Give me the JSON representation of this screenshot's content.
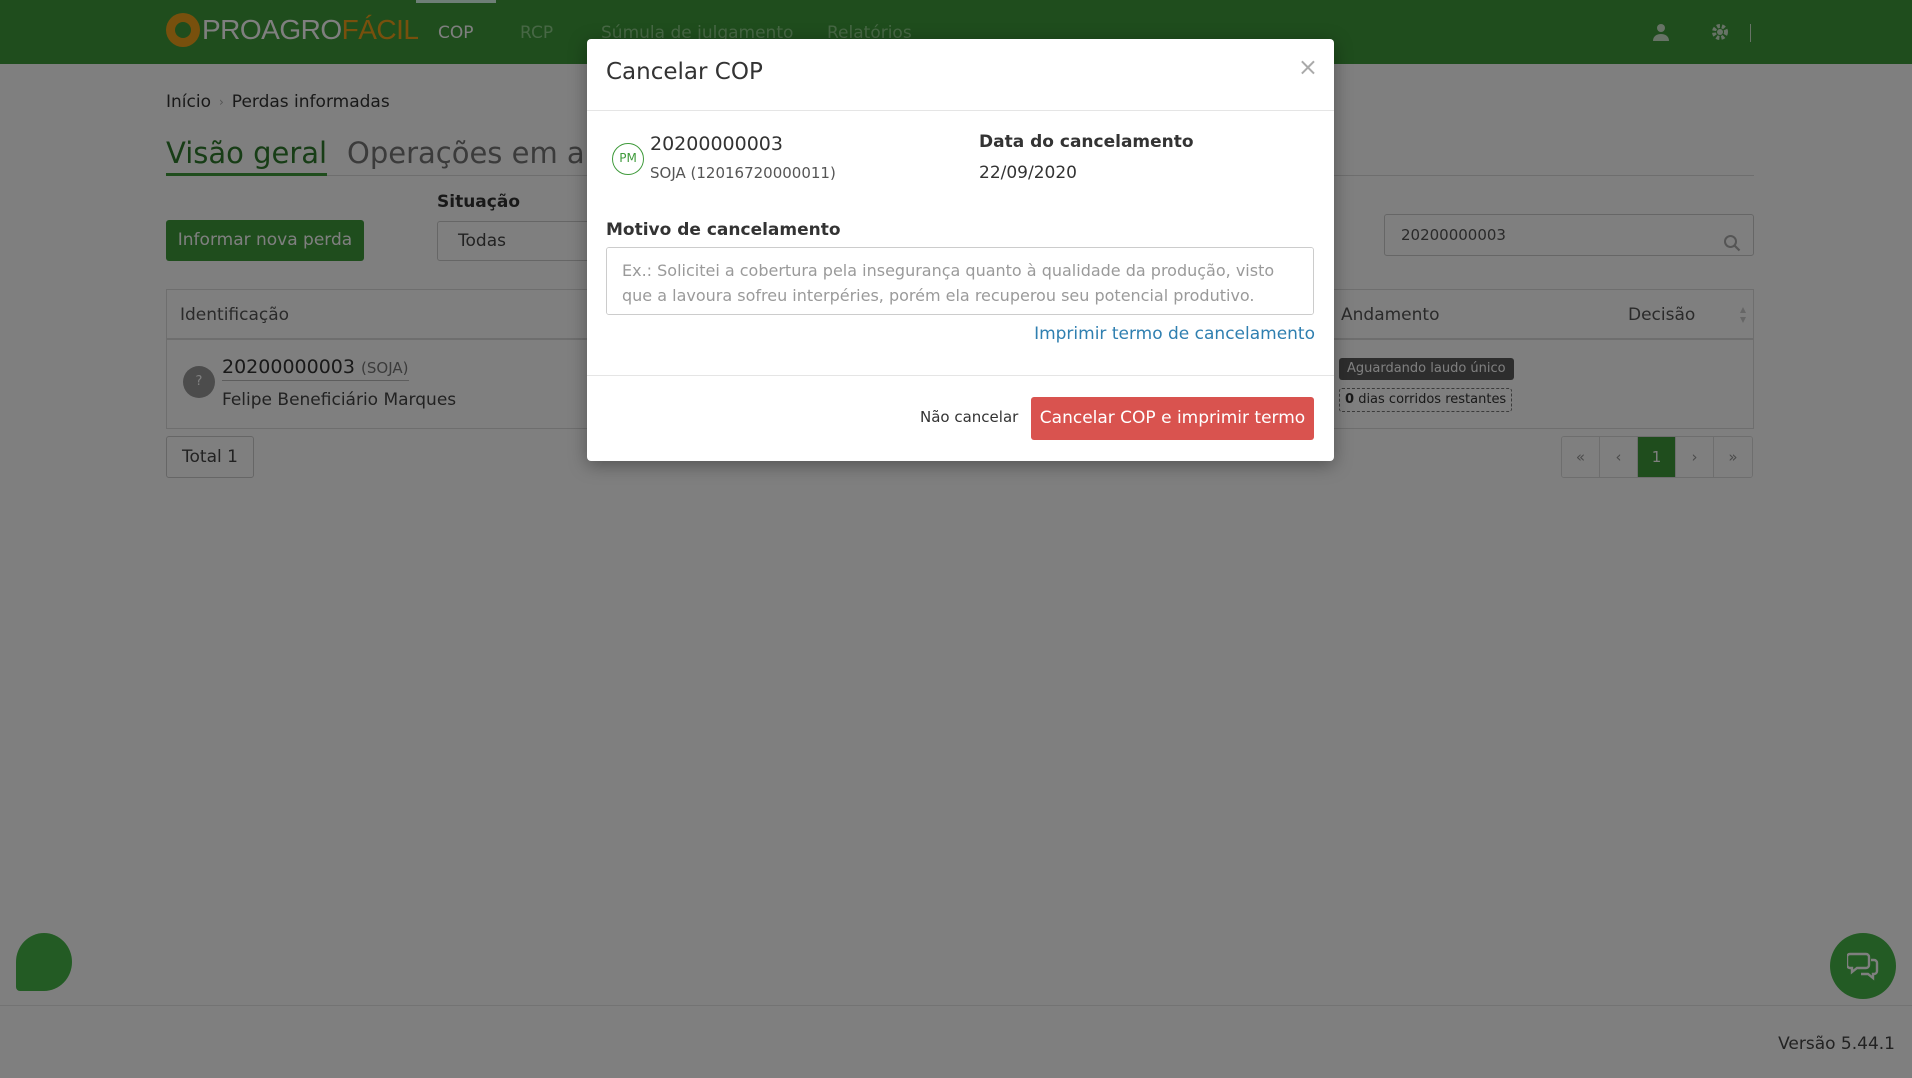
{
  "navbar": {
    "logo_text_a": "PROAGRO",
    "logo_text_b": "FÁCIL",
    "tabs": [
      {
        "label": "COP"
      },
      {
        "label": "RCP"
      },
      {
        "label": "Súmula de julgamento"
      },
      {
        "label": "Relatórios"
      }
    ],
    "user_icon": "user-icon",
    "settings_icon": "gear-icon"
  },
  "breadcrumb": {
    "items": [
      "Início",
      "Perdas informadas"
    ],
    "separator": "›"
  },
  "page_tabs": [
    {
      "label": "Visão geral"
    },
    {
      "label": "Operações em aberto"
    }
  ],
  "actions": {
    "new_loss_label": "Informar nova perda"
  },
  "filter": {
    "label": "Situação",
    "selected": "Todas"
  },
  "search": {
    "value": "20200000003",
    "icon": "search-icon"
  },
  "table": {
    "headers": {
      "identificacao": "Identificação",
      "andamento": "Andamento",
      "decisao": "Decisão"
    },
    "rows": [
      {
        "avatar": "?",
        "id": "20200000003",
        "crop": "(SOJA)",
        "name": "Felipe Beneficiário Marques",
        "status": "Aguardando laudo único",
        "days_count": "0",
        "days_text": "dias corridos restantes"
      }
    ]
  },
  "total_label": "Total 1",
  "pagination": [
    "«",
    "‹",
    "1",
    "›",
    "»"
  ],
  "version": "Versão 5.44.1",
  "modal": {
    "title": "Cancelar COP",
    "close": "×",
    "avatar": "PM",
    "cop_number": "20200000003",
    "cop_sub": "SOJA (12016720000011)",
    "date_label": "Data do cancelamento",
    "date_value": "22/09/2020",
    "reason_label": "Motivo de cancelamento",
    "reason_placeholder": "Ex.: Solicitei a cobertura pela insegurança quanto à qualidade da produção, visto que a lavoura sofreu interpéries, porém ela recuperou seu potencial produtivo.",
    "print_link": "Imprimir termo de cancelamento",
    "no_cancel_label": "Não cancelar",
    "confirm_label": "Cancelar COP e imprimir termo"
  },
  "colors": {
    "brand_green": "#3f9a3b",
    "brand_orange": "#f0a11a",
    "danger": "#d9534f",
    "link": "#2f7fb0"
  }
}
